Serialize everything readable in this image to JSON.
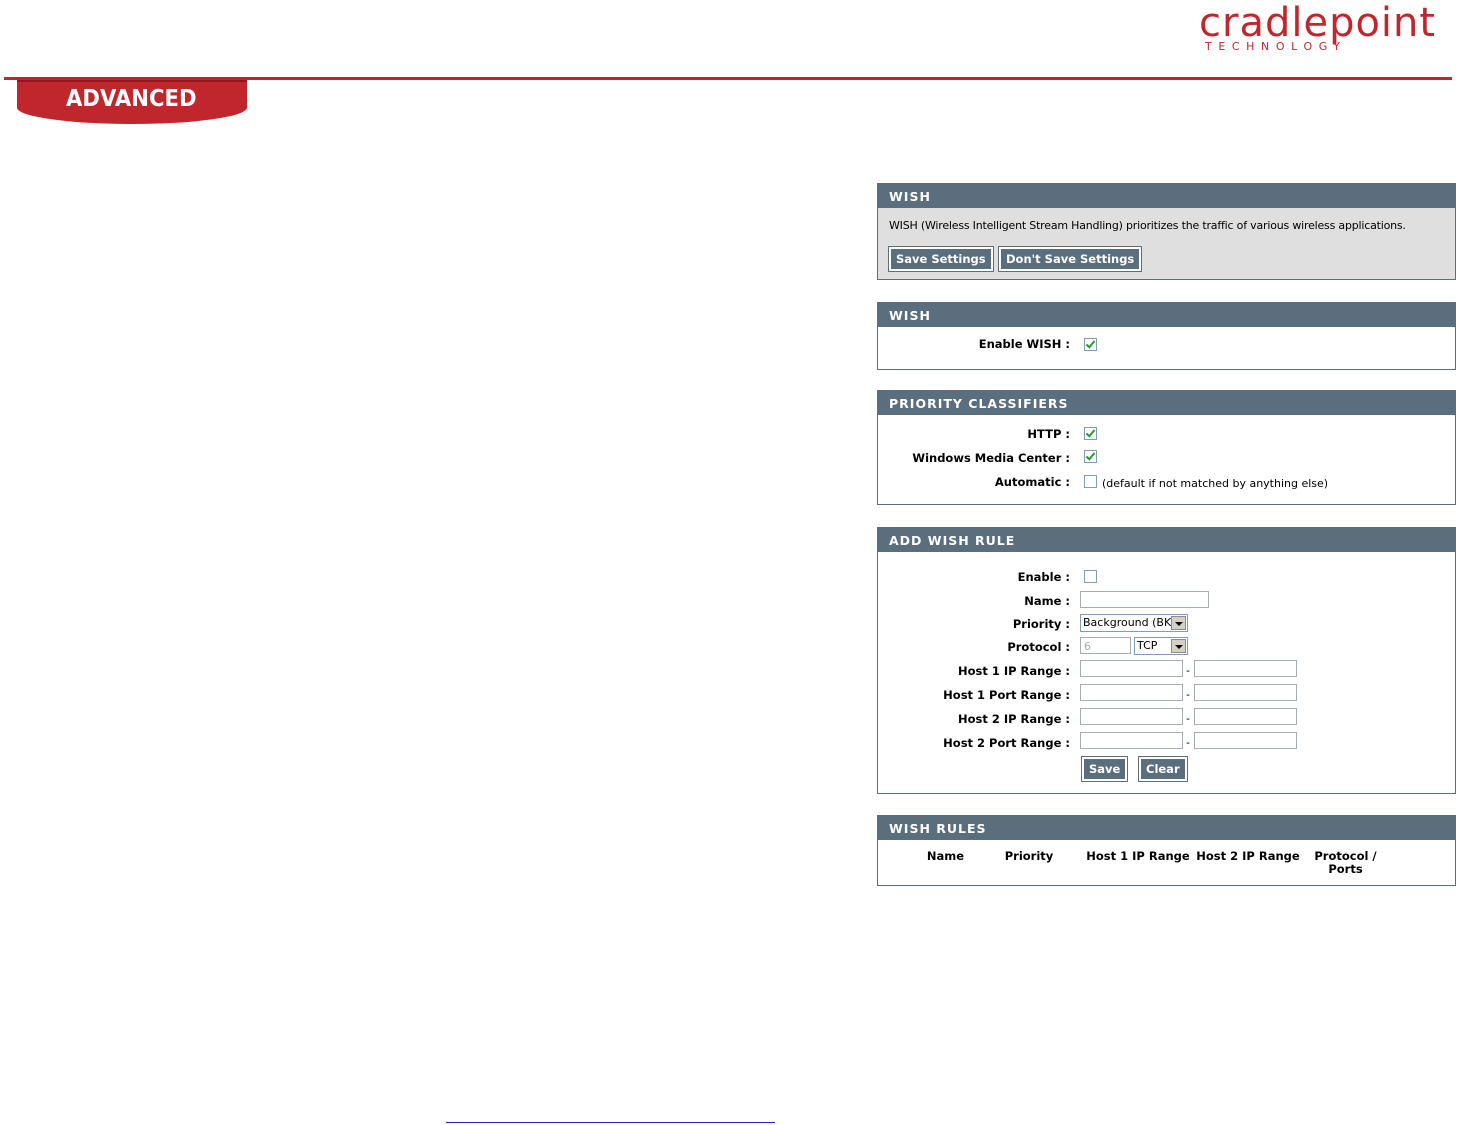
{
  "brand": {
    "name": "cradlepoint",
    "tagline": "TECHNOLOGY"
  },
  "tab": {
    "label": "ADVANCED"
  },
  "wish_intro": {
    "header": "WISH",
    "description": "WISH (Wireless Intelligent Stream Handling) prioritizes the traffic of various wireless applications.",
    "save_label": "Save Settings",
    "dont_save_label": "Don't Save Settings"
  },
  "wish": {
    "header": "WISH",
    "enable_label": "Enable WISH :",
    "enable_checked": true
  },
  "priority_classifiers": {
    "header": "PRIORITY CLASSIFIERS",
    "http_label": "HTTP :",
    "http_checked": true,
    "wmc_label": "Windows Media Center :",
    "wmc_checked": true,
    "automatic_label": "Automatic :",
    "automatic_checked": false,
    "automatic_note": "(default if not matched by anything else)"
  },
  "add_rule": {
    "header": "ADD WISH RULE",
    "enable_label": "Enable :",
    "name_label": "Name :",
    "name_value": "",
    "priority_label": "Priority :",
    "priority_value": "Background (BK)",
    "protocol_label": "Protocol :",
    "protocol_number": "6",
    "protocol_value": "TCP",
    "host1_ip_label": "Host 1 IP Range :",
    "host1_port_label": "Host 1 Port Range :",
    "host2_ip_label": "Host 2 IP Range :",
    "host2_port_label": "Host 2 Port Range :",
    "range_separator": "-",
    "save_label": "Save",
    "clear_label": "Clear"
  },
  "rules": {
    "header": "WISH RULES",
    "columns": [
      "Name",
      "Priority",
      "Host 1 IP Range",
      "Host 2 IP Range",
      "Protocol /",
      "Ports"
    ]
  },
  "colors": {
    "brand_red": "#c0272d",
    "panel_header": "#5a6e7e"
  }
}
